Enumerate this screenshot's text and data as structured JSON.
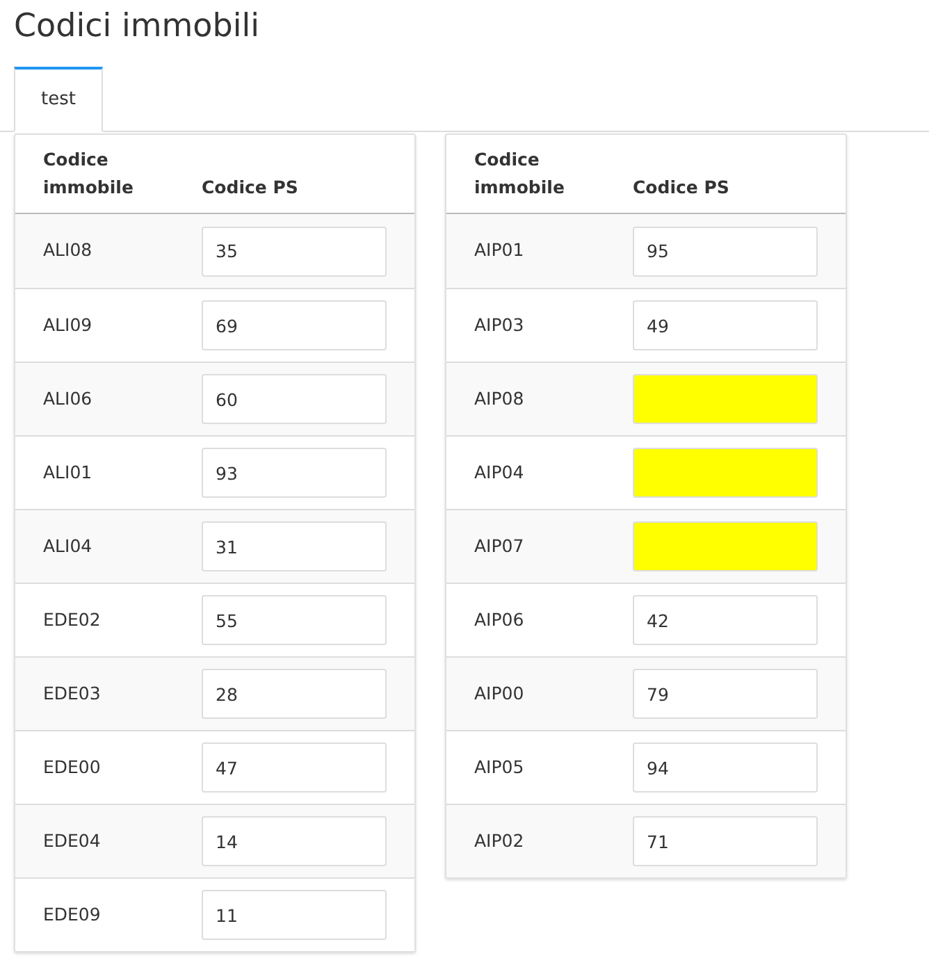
{
  "title": "Codici immobili",
  "tabs": [
    {
      "label": "test",
      "selected": true
    }
  ],
  "tables": [
    {
      "columns": [
        "Codice immobile",
        "Codice PS"
      ],
      "rows": [
        {
          "code": "ALI08",
          "value": "35",
          "highlighted": false
        },
        {
          "code": "ALI09",
          "value": "69",
          "highlighted": false
        },
        {
          "code": "ALI06",
          "value": "60",
          "highlighted": false
        },
        {
          "code": "ALI01",
          "value": "93",
          "highlighted": false
        },
        {
          "code": "ALI04",
          "value": "31",
          "highlighted": false
        },
        {
          "code": "EDE02",
          "value": "55",
          "highlighted": false
        },
        {
          "code": "EDE03",
          "value": "28",
          "highlighted": false
        },
        {
          "code": "EDE00",
          "value": "47",
          "highlighted": false
        },
        {
          "code": "EDE04",
          "value": "14",
          "highlighted": false
        },
        {
          "code": "EDE09",
          "value": "11",
          "highlighted": false
        }
      ]
    },
    {
      "columns": [
        "Codice immobile",
        "Codice PS"
      ],
      "rows": [
        {
          "code": "AIP01",
          "value": "95",
          "highlighted": false
        },
        {
          "code": "AIP03",
          "value": "49",
          "highlighted": false
        },
        {
          "code": "AIP08",
          "highlighted": true
        },
        {
          "code": "AIP04",
          "highlighted": true
        },
        {
          "code": "AIP07",
          "highlighted": true
        },
        {
          "code": "AIP06",
          "value": "42",
          "highlighted": false
        },
        {
          "code": "AIP00",
          "value": "79",
          "highlighted": false
        },
        {
          "code": "AIP05",
          "value": "94",
          "highlighted": false
        },
        {
          "code": "AIP02",
          "value": "71",
          "highlighted": false
        }
      ]
    }
  ]
}
